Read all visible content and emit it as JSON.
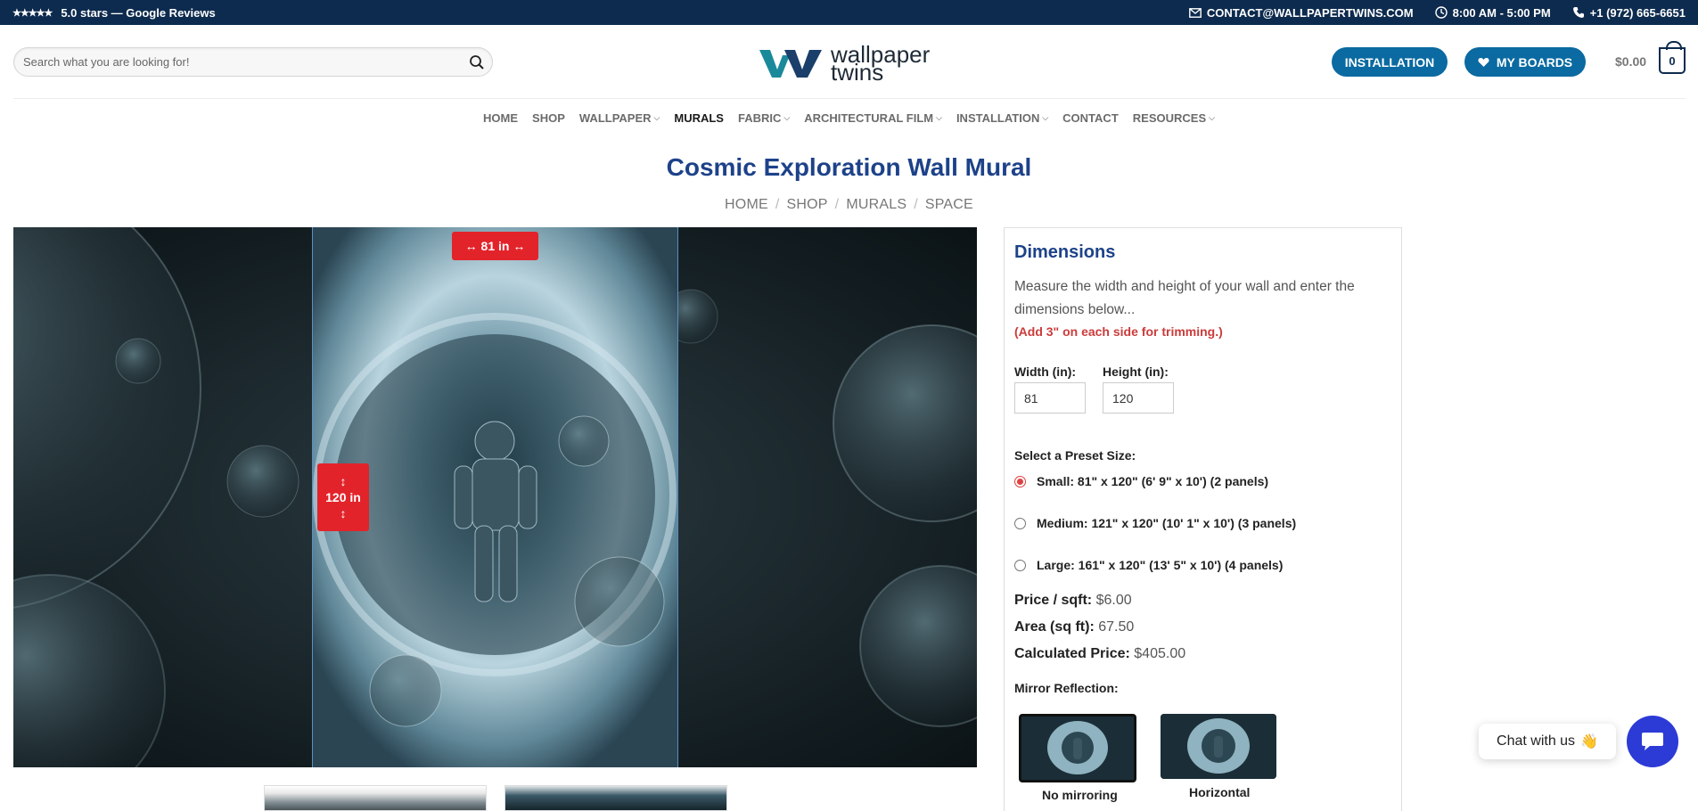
{
  "topbar": {
    "stars": "★★★★★",
    "rating_text": "5.0 stars — Google Reviews",
    "email": "CONTACT@WALLPAPERTWINS.COM",
    "hours": "8:00 AM - 5:00 PM",
    "phone": "+1 (972) 665-6651"
  },
  "header": {
    "search_placeholder": "Search what you are looking for!",
    "logo_line1": "wallpaper",
    "logo_line2": "twins",
    "installation_label": "INSTALLATION",
    "boards_label": "MY BOARDS",
    "cart_total": "$0.00",
    "cart_count": "0"
  },
  "nav": {
    "items": [
      {
        "label": "HOME",
        "dropdown": false
      },
      {
        "label": "SHOP",
        "dropdown": false
      },
      {
        "label": "WALLPAPER",
        "dropdown": true
      },
      {
        "label": "MURALS",
        "dropdown": false,
        "active": true
      },
      {
        "label": "FABRIC",
        "dropdown": true
      },
      {
        "label": "ARCHITECTURAL FILM",
        "dropdown": true
      },
      {
        "label": "INSTALLATION",
        "dropdown": true
      },
      {
        "label": "CONTACT",
        "dropdown": false
      },
      {
        "label": "RESOURCES",
        "dropdown": true
      }
    ]
  },
  "page": {
    "title": "Cosmic Exploration Wall Mural",
    "breadcrumb": [
      "HOME",
      "SHOP",
      "MURALS",
      "SPACE"
    ]
  },
  "preview": {
    "width_badge": "↔ 81 in ↔",
    "height_badge_arrow": "↕",
    "height_badge_value": "120 in"
  },
  "dimensions": {
    "heading": "Dimensions",
    "description": "Measure the width and height of your wall and enter the dimensions below...",
    "note": "(Add 3\" on each side for trimming.)",
    "width_label": "Width (in):",
    "height_label": "Height (in):",
    "width_value": "81",
    "height_value": "120",
    "preset_label": "Select a Preset Size:",
    "presets": [
      {
        "label": "Small: 81\" x 120\" (6' 9\" x 10') (2 panels)",
        "selected": true
      },
      {
        "label": "Medium: 121\" x 120\" (10' 1\" x 10') (3 panels)",
        "selected": false
      },
      {
        "label": "Large: 161\" x 120\" (13' 5\" x 10') (4 panels)",
        "selected": false
      }
    ],
    "price_sqft_label": "Price / sqft:",
    "price_sqft_value": "$6.00",
    "area_label": "Area (sq ft):",
    "area_value": "67.50",
    "calc_label": "Calculated Price:",
    "calc_value": "$405.00",
    "mirror_label": "Mirror Reflection:",
    "mirror_options": [
      {
        "label": "No mirroring",
        "selected": true
      },
      {
        "label": "Horizontal",
        "selected": false
      }
    ]
  },
  "chat": {
    "label": "Chat with us",
    "emoji": "👋"
  }
}
